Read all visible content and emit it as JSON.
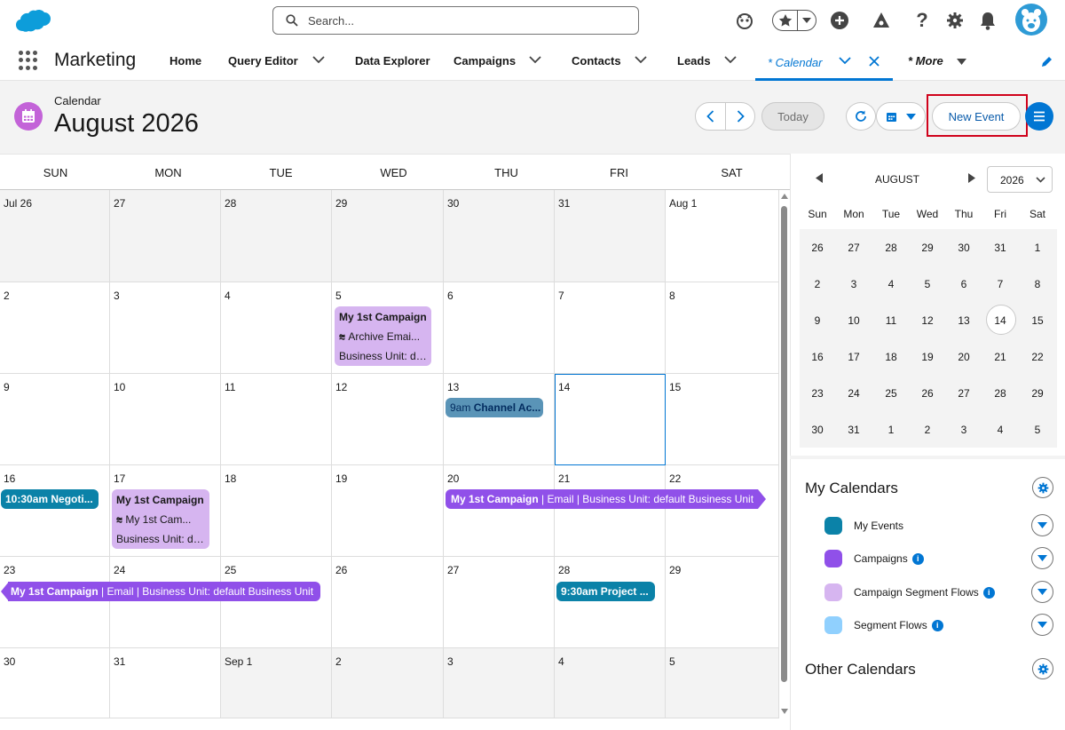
{
  "topbar": {
    "search_placeholder": "Search..."
  },
  "nav": {
    "app_name": "Marketing",
    "items": [
      {
        "label": "Home"
      },
      {
        "label": "Query Editor"
      },
      {
        "label": "Data Explorer"
      },
      {
        "label": "Campaigns"
      },
      {
        "label": "Contacts"
      },
      {
        "label": "Leads"
      }
    ],
    "active_tab": "* Calendar",
    "more": "* More"
  },
  "header": {
    "breadcrumb": "Calendar",
    "title": "August 2026",
    "today": "Today",
    "new_event": "New Event"
  },
  "calendar": {
    "dow": [
      "SUN",
      "MON",
      "TUE",
      "WED",
      "THU",
      "FRI",
      "SAT"
    ],
    "weeks": [
      [
        "Jul 26",
        "27",
        "28",
        "29",
        "30",
        "31",
        "Aug 1"
      ],
      [
        "2",
        "3",
        "4",
        "5",
        "6",
        "7",
        "8"
      ],
      [
        "9",
        "10",
        "11",
        "12",
        "13",
        "14",
        "15"
      ],
      [
        "16",
        "17",
        "18",
        "19",
        "20",
        "21",
        "22"
      ],
      [
        "23",
        "24",
        "25",
        "26",
        "27",
        "28",
        "29"
      ],
      [
        "30",
        "31",
        "Sep 1",
        "2",
        "3",
        "4",
        "5"
      ]
    ],
    "events": {
      "aug5_title": "My 1st Campaign",
      "aug5_line2": "Archive Emai...",
      "aug5_line3": "Business Unit: de...",
      "aug13_time": "9am",
      "aug13_title": "Channel Ac...",
      "aug16": "10:30am Negoti...",
      "aug17_title": "My 1st Campaign",
      "aug17_line2": "My 1st Cam...",
      "aug17_line3": "Business Unit: de...",
      "aug20_bar_title": "My 1st Campaign",
      "aug20_bar_rest": " | Email | Business Unit: default Business Unit",
      "aug23_bar_title": "My 1st Campaign",
      "aug23_bar_rest": " | Email | Business Unit: default Business Unit",
      "aug28": "9:30am Project ..."
    }
  },
  "mini": {
    "month": "AUGUST",
    "year": "2026",
    "dow": [
      "Sun",
      "Mon",
      "Tue",
      "Wed",
      "Thu",
      "Fri",
      "Sat"
    ],
    "weeks": [
      [
        "26",
        "27",
        "28",
        "29",
        "30",
        "31",
        "1"
      ],
      [
        "2",
        "3",
        "4",
        "5",
        "6",
        "7",
        "8"
      ],
      [
        "9",
        "10",
        "11",
        "12",
        "13",
        "14",
        "15"
      ],
      [
        "16",
        "17",
        "18",
        "19",
        "20",
        "21",
        "22"
      ],
      [
        "23",
        "24",
        "25",
        "26",
        "27",
        "28",
        "29"
      ],
      [
        "30",
        "31",
        "1",
        "2",
        "3",
        "4",
        "5"
      ]
    ]
  },
  "my_calendars": {
    "title": "My Calendars",
    "items": [
      {
        "name": "My Events",
        "color": "#0b82a8"
      },
      {
        "name": "Campaigns",
        "color": "#9050e9"
      },
      {
        "name": "Campaign Segment Flows",
        "color": "#d6b5f0"
      },
      {
        "name": "Segment Flows",
        "color": "#90d0fe"
      }
    ]
  },
  "other_calendars": {
    "title": "Other Calendars"
  },
  "colors": {
    "brand": "#0176d3",
    "highlight": "#d0021b"
  }
}
